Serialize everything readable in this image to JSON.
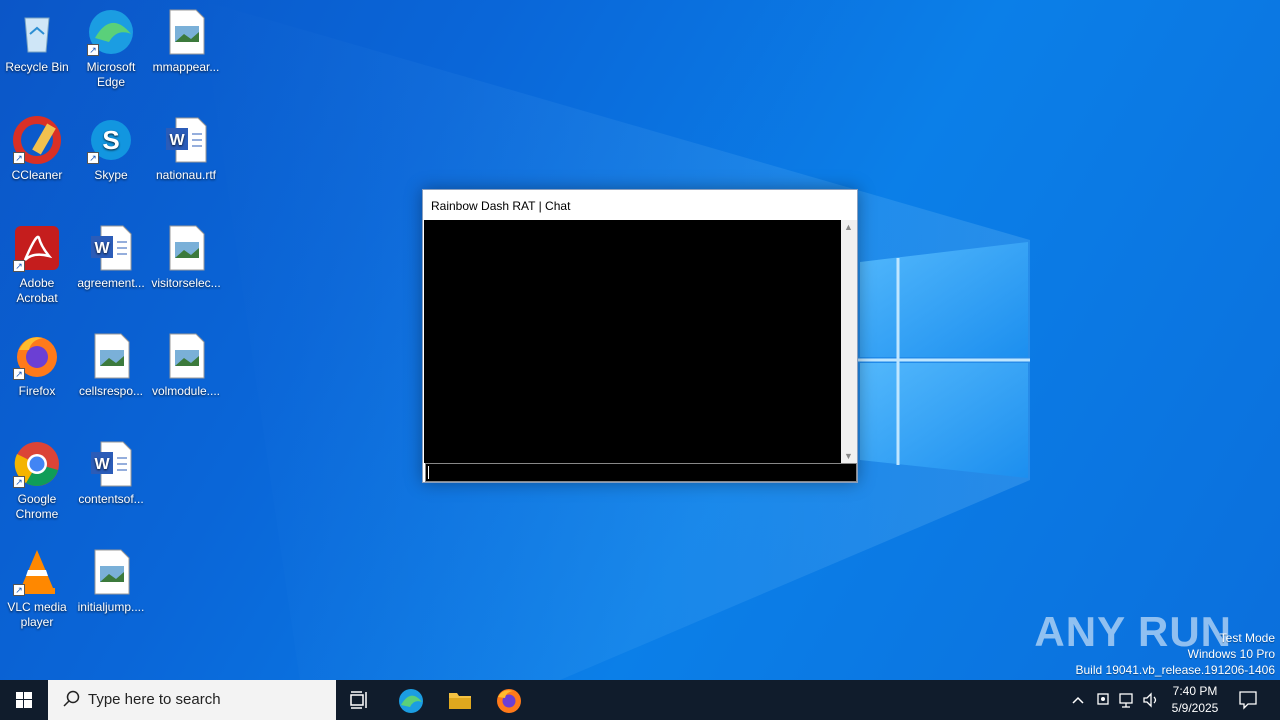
{
  "desktop": {
    "icons": [
      {
        "label": "Recycle Bin",
        "icon": "recycle-bin-icon"
      },
      {
        "label": "Microsoft Edge",
        "icon": "edge-icon"
      },
      {
        "label": "mmappear...",
        "icon": "image-file-icon"
      },
      {
        "label": "CCleaner",
        "icon": "ccleaner-icon"
      },
      {
        "label": "Skype",
        "icon": "skype-icon"
      },
      {
        "label": "nationau.rtf",
        "icon": "word-document-icon"
      },
      {
        "label": "Adobe Acrobat",
        "icon": "acrobat-icon"
      },
      {
        "label": "agreement...",
        "icon": "word-document-icon"
      },
      {
        "label": "visitorselec...",
        "icon": "image-file-icon"
      },
      {
        "label": "Firefox",
        "icon": "firefox-icon"
      },
      {
        "label": "cellsrespo...",
        "icon": "image-file-icon"
      },
      {
        "label": "volmodule....",
        "icon": "image-file-icon"
      },
      {
        "label": "Google Chrome",
        "icon": "chrome-icon"
      },
      {
        "label": "contentsof...",
        "icon": "word-document-icon"
      },
      {
        "label": "VLC media player",
        "icon": "vlc-icon"
      },
      {
        "label": "initialjump....",
        "icon": "image-file-icon"
      }
    ]
  },
  "chat_window": {
    "title": "Rainbow Dash RAT | Chat",
    "output_text": "",
    "input_value": ""
  },
  "watermark": {
    "brand": "ANY RUN",
    "line1": "Test Mode",
    "line2": "Windows 10 Pro",
    "line3": "Build 19041.vb_release.191206-1406"
  },
  "taskbar": {
    "search_placeholder": "Type here to search",
    "apps": [
      "task-view-icon",
      "edge-icon",
      "file-explorer-icon",
      "firefox-icon"
    ],
    "clock_time": "7:40 PM",
    "clock_date": "5/9/2025"
  },
  "colors": {
    "wallpaper": "#0a66d8",
    "taskbar": "#101c2c",
    "console": "#000000"
  }
}
